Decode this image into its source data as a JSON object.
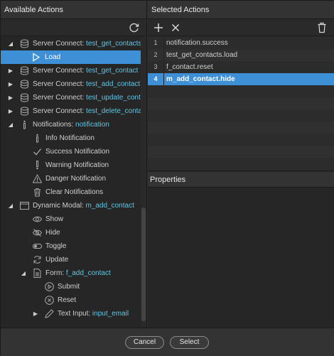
{
  "left_panel": {
    "title": "Available Actions"
  },
  "right_panel": {
    "title": "Selected Actions",
    "properties_title": "Properties"
  },
  "tree": [
    {
      "prefix": "Server Connect: ",
      "name": "test_get_contacts",
      "expand": "down"
    },
    {
      "prefix": "Load",
      "name": "",
      "expand": "",
      "selected": true
    },
    {
      "prefix": "Server Connect: ",
      "name": "test_get_contact",
      "expand": "right"
    },
    {
      "prefix": "Server Connect: ",
      "name": "test_add_contact",
      "expand": "right"
    },
    {
      "prefix": "Server Connect: ",
      "name": "test_update_contact",
      "expand": "right"
    },
    {
      "prefix": "Server Connect: ",
      "name": "test_delete_contact",
      "expand": "right"
    },
    {
      "prefix": "Notifications: ",
      "name": "notification",
      "expand": "down"
    },
    {
      "prefix": "Info Notification",
      "name": "",
      "expand": ""
    },
    {
      "prefix": "Success Notification",
      "name": "",
      "expand": ""
    },
    {
      "prefix": "Warning Notification",
      "name": "",
      "expand": ""
    },
    {
      "prefix": "Danger Notification",
      "name": "",
      "expand": ""
    },
    {
      "prefix": "Clear Notifications",
      "name": "",
      "expand": ""
    },
    {
      "prefix": "Dynamic Modal: ",
      "name": "m_add_contact",
      "expand": "down"
    },
    {
      "prefix": "Show",
      "name": "",
      "expand": ""
    },
    {
      "prefix": "Hide",
      "name": "",
      "expand": ""
    },
    {
      "prefix": "Toggle",
      "name": "",
      "expand": ""
    },
    {
      "prefix": "Update",
      "name": "",
      "expand": ""
    },
    {
      "prefix": "Form: ",
      "name": "f_add_contact",
      "expand": "down"
    },
    {
      "prefix": "Submit",
      "name": "",
      "expand": ""
    },
    {
      "prefix": "Reset",
      "name": "",
      "expand": ""
    },
    {
      "prefix": "Text Input: ",
      "name": "input_email",
      "expand": "right"
    }
  ],
  "selected_actions": [
    {
      "num": "1",
      "value": "notification.success"
    },
    {
      "num": "2",
      "value": "test_get_contacts.load"
    },
    {
      "num": "3",
      "value": "f_contact.reset"
    },
    {
      "num": "4",
      "value": "m_add_contact.hide",
      "selected": true
    }
  ],
  "footer": {
    "cancel": "Cancel",
    "select": "Select"
  },
  "colors": {
    "accent": "#3d8fd6",
    "highlight_text": "#5fc6e6"
  }
}
